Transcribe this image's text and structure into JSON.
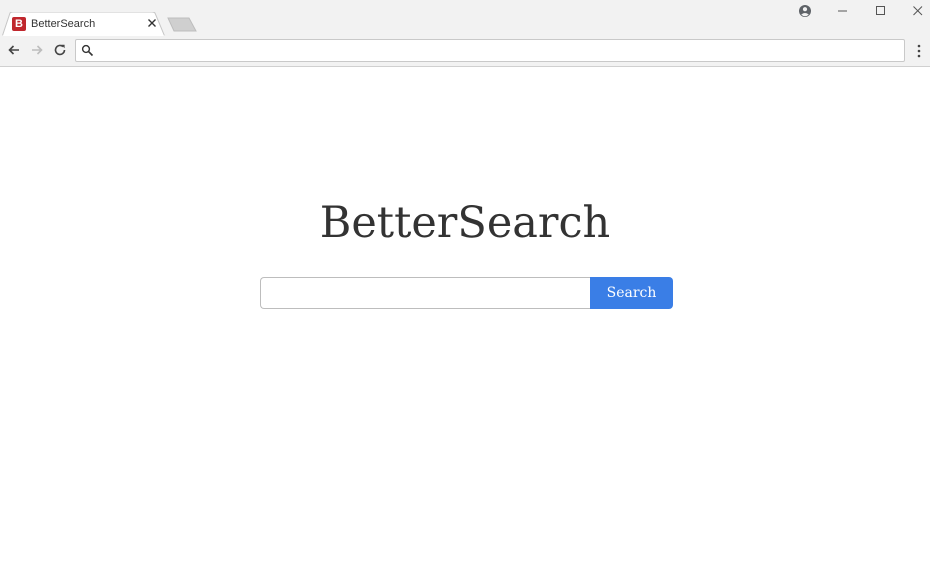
{
  "tab": {
    "favicon_letter": "B",
    "title": "BetterSearch",
    "favicon_color": "#c0272d"
  },
  "window_controls": [
    "profile-icon",
    "minimize-icon",
    "maximize-icon",
    "close-icon"
  ],
  "toolbar": {
    "back_icon": "back-arrow-icon",
    "forward_icon": "forward-arrow-icon",
    "reload_icon": "reload-icon",
    "omnibox_value": "",
    "omnibox_icon": "search-icon",
    "menu_icon": "kebab-menu-icon"
  },
  "page": {
    "brand": "BetterSearch",
    "search_value": "",
    "search_button_label": "Search",
    "accent_color": "#3a7ee6"
  }
}
